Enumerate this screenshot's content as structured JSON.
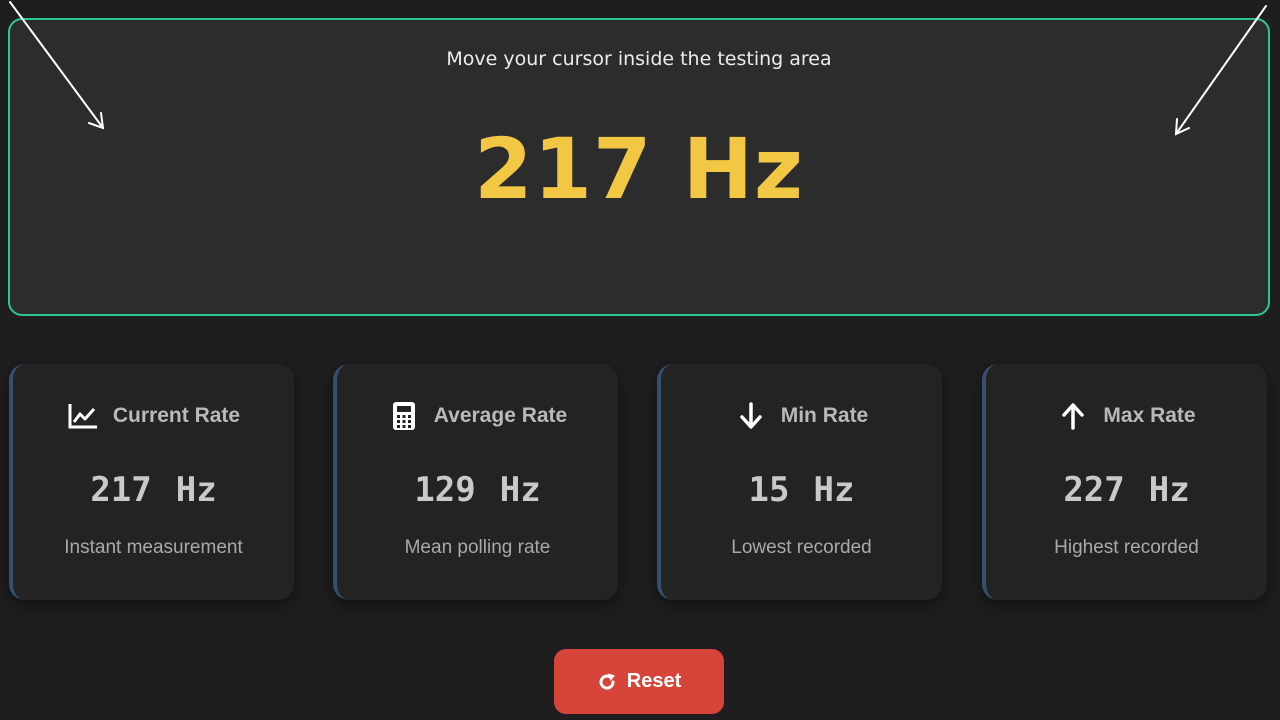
{
  "test_area": {
    "instruction": "Move your cursor inside the testing area",
    "current_rate_display": "217 Hz",
    "border_color": "#2fc39a",
    "rate_color": "#f2c744"
  },
  "cards": [
    {
      "icon": "line-chart-icon",
      "title": "Current Rate",
      "value": "217",
      "unit": "Hz",
      "description": "Instant measurement"
    },
    {
      "icon": "calculator-icon",
      "title": "Average Rate",
      "value": "129",
      "unit": "Hz",
      "description": "Mean polling rate"
    },
    {
      "icon": "arrow-down-icon",
      "title": "Min Rate",
      "value": "15",
      "unit": "Hz",
      "description": "Lowest recorded"
    },
    {
      "icon": "arrow-up-icon",
      "title": "Max Rate",
      "value": "227",
      "unit": "Hz",
      "description": "Highest recorded"
    }
  ],
  "reset": {
    "icon": "refresh-icon",
    "label": "Reset",
    "color": "#d7443a"
  }
}
